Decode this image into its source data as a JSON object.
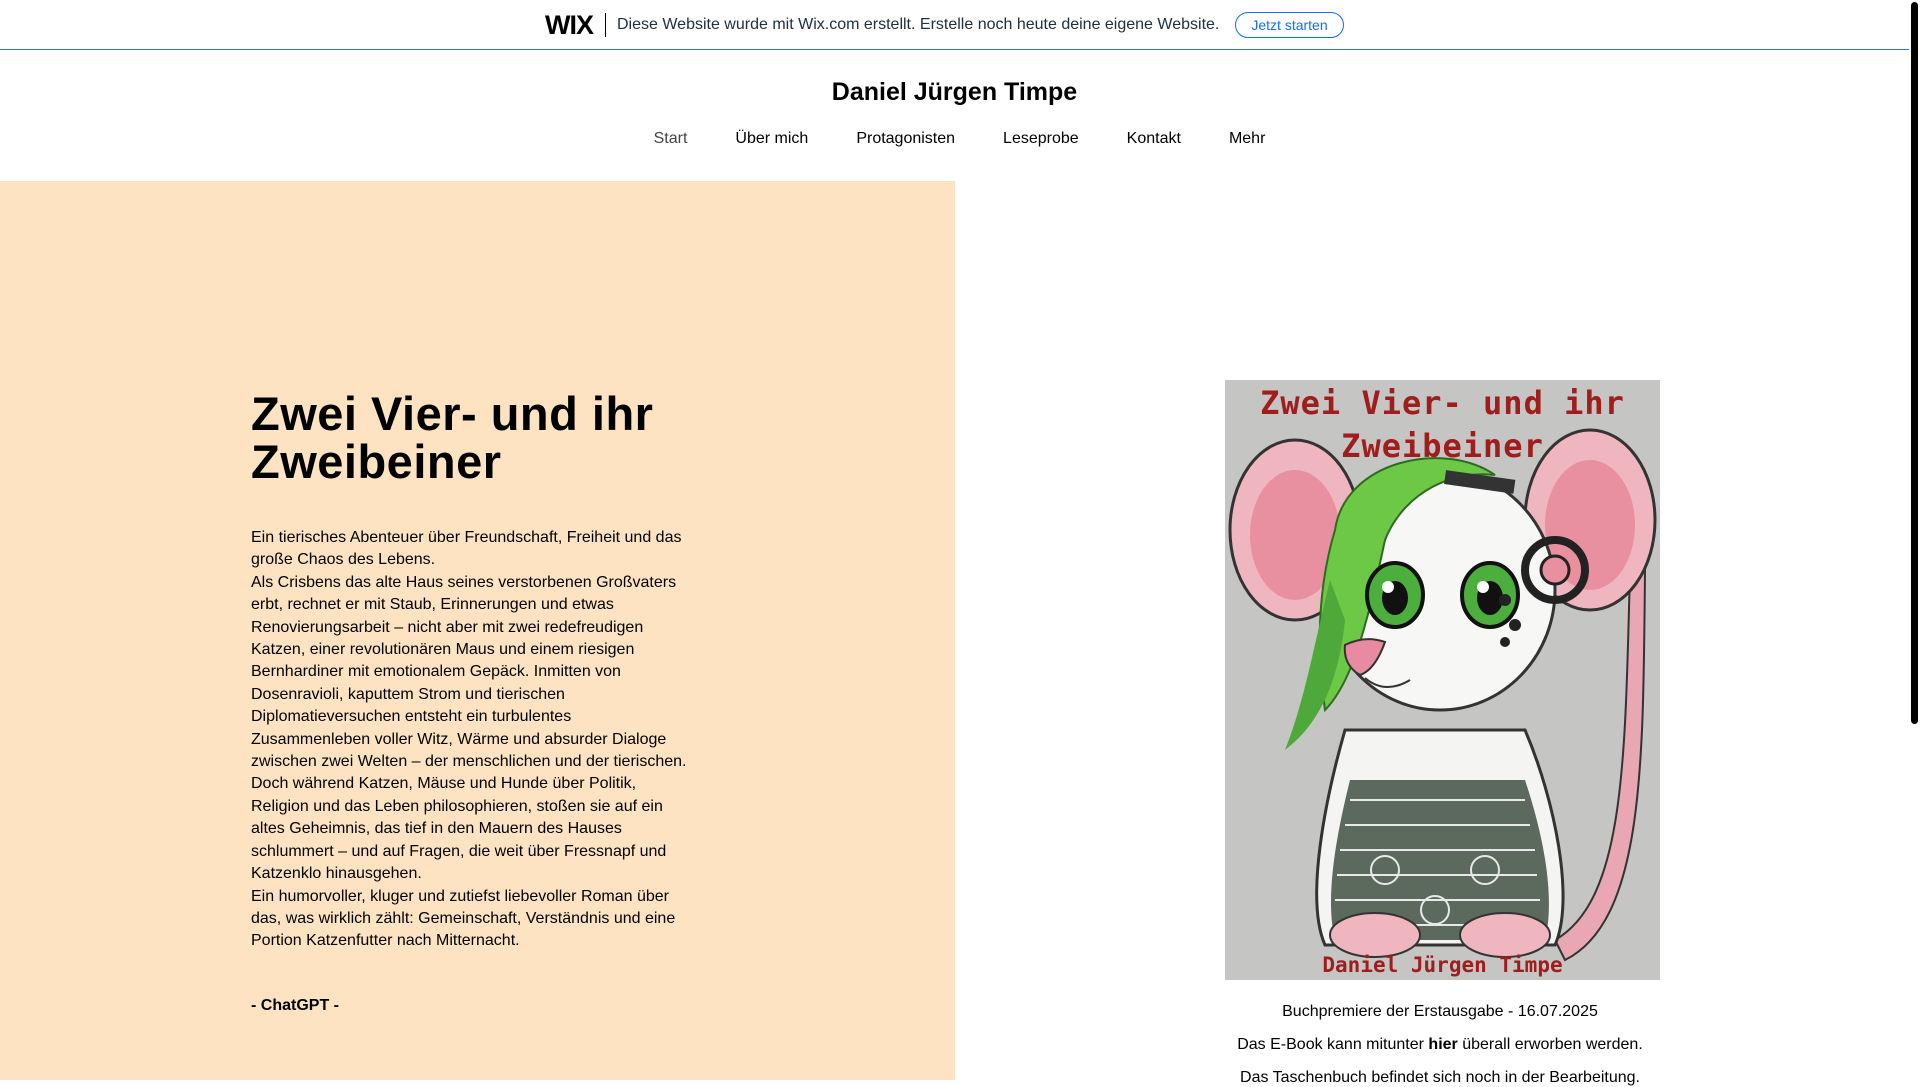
{
  "wix_banner": {
    "logo": "WIX",
    "text": "Diese Website wurde mit Wix.com erstellt. Erstelle noch heute deine eigene Website.",
    "button_label": "Jetzt starten"
  },
  "site": {
    "title": "Daniel Jürgen Timpe"
  },
  "nav": {
    "items": [
      {
        "label": "Start"
      },
      {
        "label": "Über mich"
      },
      {
        "label": "Protagonisten"
      },
      {
        "label": "Leseprobe"
      },
      {
        "label": "Kontakt"
      },
      {
        "label": "Mehr"
      }
    ]
  },
  "book": {
    "title_line1": "Zwei Vier- und ihr",
    "title_line2": "Zweibeiner",
    "paragraphs": [
      "Ein tierisches Abenteuer über Freundschaft, Freiheit und das große Chaos des Lebens.",
      "Als Crisbens das alte Haus seines verstorbenen Großvaters erbt, rechnet er mit Staub, Erinnerungen und etwas Renovierungsarbeit – nicht aber mit zwei redefreudigen Katzen, einer revolutionären Maus und einem riesigen Bernhardiner mit emotionalem Gepäck. Inmitten von Dosenravioli, kaputtem Strom und tierischen Diplomatieversuchen entsteht ein turbulentes Zusammenleben voller Witz, Wärme und absurder Dialoge zwischen zwei Welten – der menschlichen und der tierischen.",
      "Doch während Katzen, Mäuse und Hunde über Politik, Religion und das Leben philosophieren, stoßen sie auf ein altes Geheimnis, das tief in den Mauern des Hauses schlummert – und auf Fragen, die weit über Fressnapf und Katzenklo hinausgehen.",
      "Ein humorvoller, kluger und zutiefst liebevoller Roman über das, was wirklich zählt: Gemeinschaft, Verständnis und eine Portion Katzenfutter nach Mitternacht."
    ],
    "signature": "- ChatGPT -"
  },
  "cover": {
    "title_line1": "Zwei Vier- und ihr",
    "title_line2": "Zweibeiner",
    "author": "Daniel Jürgen Timpe"
  },
  "captions": {
    "premiere": "Buchpremiere der Erstausgabe - 16.07.2025",
    "ebook_before": "Das E-Book kann mitunter ",
    "ebook_link": "hier",
    "ebook_after": " überall erworben werden.",
    "paperback": "Das Taschenbuch befindet sich noch in der Bearbeitung."
  },
  "colors": {
    "left_panel": "#fde3c2",
    "wix_blue": "#116dff",
    "cover_text": "#a01d1d"
  }
}
